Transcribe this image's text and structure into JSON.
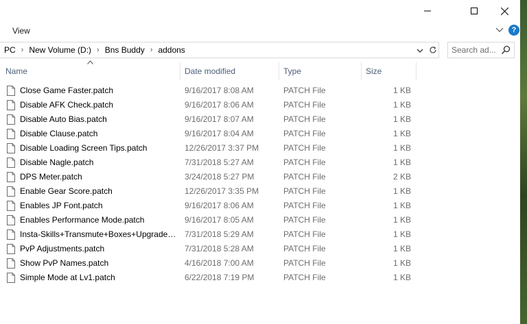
{
  "ribbon": {
    "view_label": "View",
    "help_label": "?"
  },
  "address": {
    "crumbs": [
      "PC",
      "New Volume (D:)",
      "Bns Buddy",
      "addons"
    ],
    "separator": "›"
  },
  "search": {
    "placeholder": "Search ad..."
  },
  "columns": {
    "name": "Name",
    "date": "Date modified",
    "type": "Type",
    "size": "Size"
  },
  "files": [
    {
      "name": "Close Game Faster.patch",
      "date": "9/16/2017 8:08 AM",
      "type": "PATCH File",
      "size": "1 KB"
    },
    {
      "name": "Disable AFK Check.patch",
      "date": "9/16/2017 8:06 AM",
      "type": "PATCH File",
      "size": "1 KB"
    },
    {
      "name": "Disable Auto Bias.patch",
      "date": "9/16/2017 8:07 AM",
      "type": "PATCH File",
      "size": "1 KB"
    },
    {
      "name": "Disable Clause.patch",
      "date": "9/16/2017 8:04 AM",
      "type": "PATCH File",
      "size": "1 KB"
    },
    {
      "name": "Disable Loading Screen Tips.patch",
      "date": "12/26/2017 3:37 PM",
      "type": "PATCH File",
      "size": "1 KB"
    },
    {
      "name": "Disable Nagle.patch",
      "date": "7/31/2018 5:27 AM",
      "type": "PATCH File",
      "size": "1 KB"
    },
    {
      "name": "DPS Meter.patch",
      "date": "3/24/2018 5:27 PM",
      "type": "PATCH File",
      "size": "2 KB"
    },
    {
      "name": "Enable Gear Score.patch",
      "date": "12/26/2017 3:35 PM",
      "type": "PATCH File",
      "size": "1 KB"
    },
    {
      "name": "Enables JP Font.patch",
      "date": "9/16/2017 8:06 AM",
      "type": "PATCH File",
      "size": "1 KB"
    },
    {
      "name": "Enables Performance Mode.patch",
      "date": "9/16/2017 8:05 AM",
      "type": "PATCH File",
      "size": "1 KB"
    },
    {
      "name": "Insta-Skills+Transmute+Boxes+Upgrades...",
      "date": "7/31/2018 5:29 AM",
      "type": "PATCH File",
      "size": "1 KB"
    },
    {
      "name": "PvP Adjustments.patch",
      "date": "7/31/2018 5:28 AM",
      "type": "PATCH File",
      "size": "1 KB"
    },
    {
      "name": "Show PvP Names.patch",
      "date": "4/16/2018 7:00 AM",
      "type": "PATCH File",
      "size": "1 KB"
    },
    {
      "name": "Simple Mode at Lv1.patch",
      "date": "6/22/2018 7:19 PM",
      "type": "PATCH File",
      "size": "1 KB"
    }
  ]
}
